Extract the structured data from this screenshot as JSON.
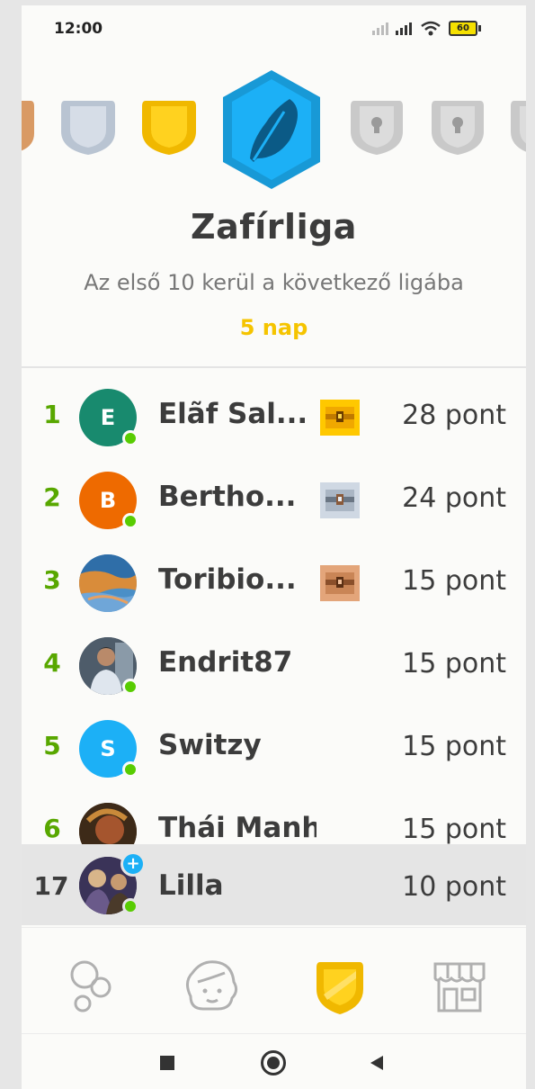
{
  "status_bar": {
    "time": "12:00",
    "battery": "60"
  },
  "league": {
    "title": "Zafírliga",
    "subtitle": "Az első 10 kerül a következő ligába",
    "days_left": "5 nap",
    "badges": [
      "bronze-shield-icon",
      "silver-shield-icon",
      "gold-shield-icon",
      "sapphire-feather-badge-icon",
      "locked-shield-icon",
      "locked-shield-icon",
      "locked-shield-icon"
    ]
  },
  "leaderboard": [
    {
      "rank": "1",
      "initial": "E",
      "avatar_color": "#188a6e",
      "name": "Elãf Sal...",
      "chest": "gold",
      "points": "28 pont",
      "online": true
    },
    {
      "rank": "2",
      "initial": "B",
      "avatar_color": "#ee6a00",
      "name": "Bertho...",
      "chest": "silver",
      "points": "24 pont",
      "online": true
    },
    {
      "rank": "3",
      "initial": "",
      "avatar_color": "#4a8fc7",
      "name": "Toribio...",
      "chest": "bronze",
      "points": "15 pont",
      "online": false
    },
    {
      "rank": "4",
      "initial": "",
      "avatar_color": "#7a8a9a",
      "name": "Endrit87",
      "chest": "",
      "points": "15 pont",
      "online": true
    },
    {
      "rank": "5",
      "initial": "S",
      "avatar_color": "#1cb0f6",
      "name": "Switzy",
      "chest": "",
      "points": "15 pont",
      "online": true
    },
    {
      "rank": "6",
      "initial": "",
      "avatar_color": "#6b4a2a",
      "name": "Thái Manh",
      "chest": "",
      "points": "15 pont",
      "online": false
    }
  ],
  "current_user": {
    "rank": "17",
    "name": "Lilla",
    "points": "10 pont",
    "plus": "+"
  },
  "tabs": [
    "learn-tab",
    "profile-tab",
    "leagues-tab",
    "shop-tab"
  ],
  "colors": {
    "accent_green": "#58a700",
    "gold": "#f5c400",
    "sapphire": "#1cb0f6"
  }
}
